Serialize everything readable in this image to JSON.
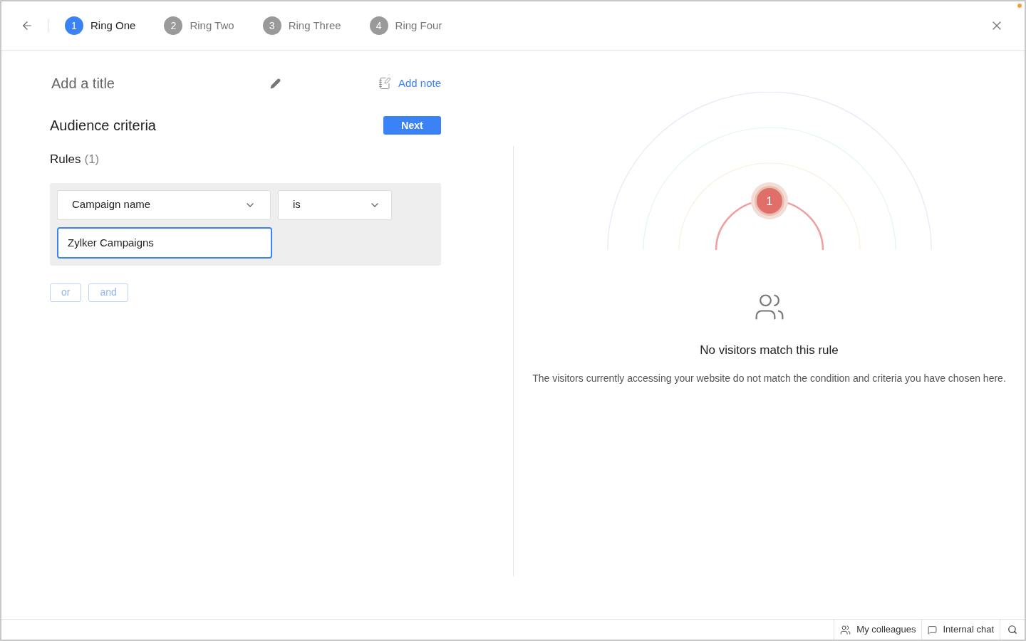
{
  "steps": [
    {
      "number": "1",
      "label": "Ring One",
      "selected": true
    },
    {
      "number": "2",
      "label": "Ring Two",
      "selected": false
    },
    {
      "number": "3",
      "label": "Ring Three",
      "selected": false
    },
    {
      "number": "4",
      "label": "Ring Four",
      "selected": false
    }
  ],
  "title_placeholder": "Add a title",
  "add_note": "Add note",
  "section_title": "Audience criteria",
  "next_button": "Next",
  "rules": {
    "label": "Rules",
    "count": "(1)",
    "field": "Campaign name",
    "operator": "is",
    "value": "Zylker Campaigns"
  },
  "connectors": [
    {
      "label": "or",
      "disabled": true
    },
    {
      "label": "and",
      "disabled": true
    }
  ],
  "preview": {
    "badge": "1",
    "heading": "No visitors match this rule",
    "message": "The visitors currently accessing your website do not match the condition and criteria you have chosen here."
  },
  "status_bar": [
    {
      "kind": "colleagues",
      "label": "My colleagues"
    },
    {
      "kind": "chat",
      "label": "Internal chat"
    }
  ]
}
